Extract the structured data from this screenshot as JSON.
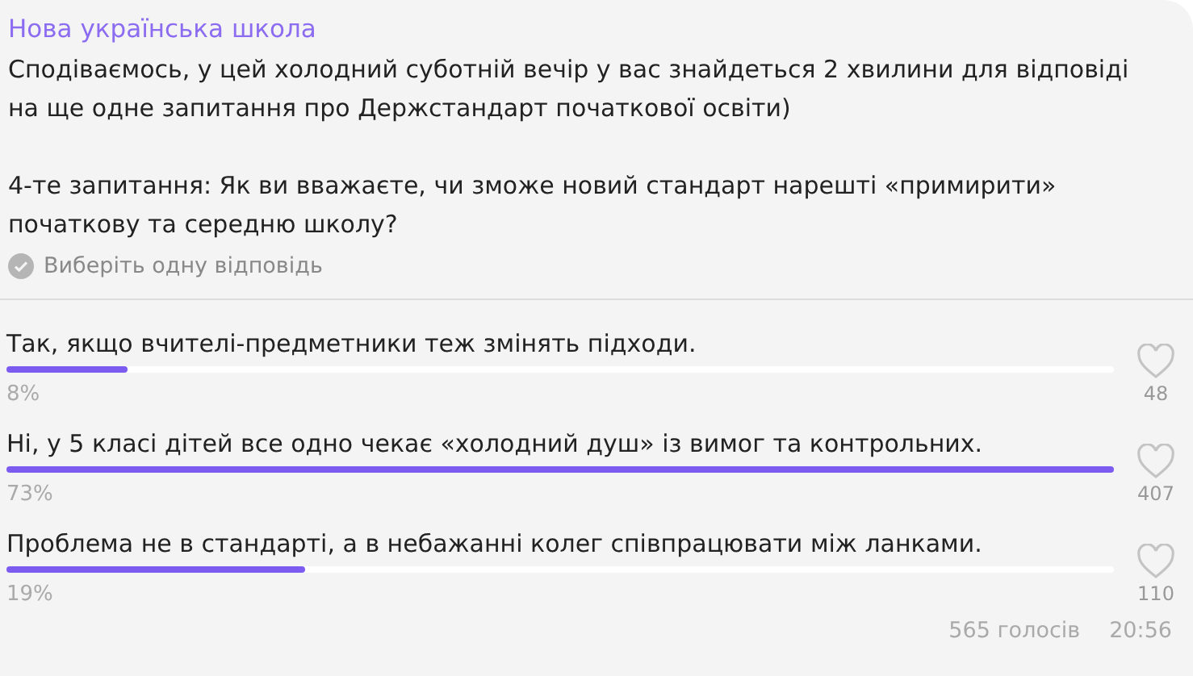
{
  "poll": {
    "channel": "Нова українська школа",
    "paragraphs": [
      "Сподіваємось, у цей холодний суботній вечір у вас знайдеться 2 хвилини для відповіді на ще одне запитання про Держстандарт початкової освіти)",
      "4-те запитання: Як ви вважаєте, чи зможе новий стандарт нарешті «примирити» початкову та середню школу?"
    ],
    "hint": "Виберіть одну відповідь",
    "options": [
      {
        "text": "Так, якщо вчителі-предметники теж змінять підходи.",
        "level": 0.11,
        "percent": "8%",
        "likes": "48"
      },
      {
        "text": "Ні, у 5 класі дітей все одно чекає «холодний душ» із вимог та контрольних.",
        "level": 1.0,
        "percent": "73%",
        "likes": "407"
      },
      {
        "text": "Проблема не в стандарті, а в небажанні колег співпрацювати між ланками.",
        "level": 0.27,
        "percent": "19%",
        "likes": "110"
      }
    ],
    "votes": "565 голосів",
    "time": "20:56"
  }
}
